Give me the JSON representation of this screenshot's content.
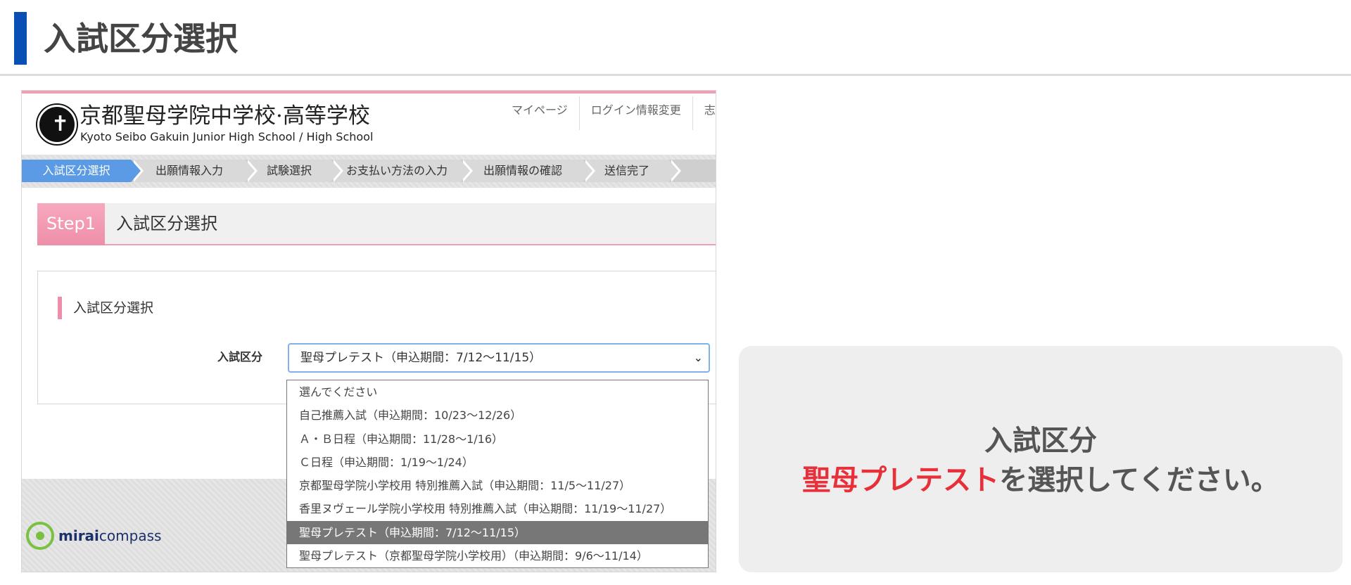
{
  "page": {
    "title": "入試区分選択"
  },
  "school": {
    "name_ja": "京都聖母学院中学校·高等学校",
    "name_en": "Kyoto Seibo Gakuin Junior High School / High School",
    "logo_icon": "cross-emblem-icon"
  },
  "topnav": [
    "マイページ",
    "ログイン情報変更",
    "志"
  ],
  "steps": [
    "入試区分選択",
    "出願情報入力",
    "試験選択",
    "お支払い方法の入力",
    "出願情報の確認",
    "送信完了"
  ],
  "step_head": {
    "badge": "Step1",
    "title": "入試区分選択"
  },
  "panel": {
    "title": "入試区分選択",
    "field_label": "入試区分",
    "selected_value": "聖母プレテスト（申込期間：7/12～11/15）"
  },
  "dropdown_options": [
    "選んでください",
    "自己推薦入試（申込期間：10/23～12/26）",
    "Ａ・Ｂ日程（申込期間：11/28～1/16）",
    "Ｃ日程（申込期間：1/19～1/24）",
    "京都聖母学院小学校用 特別推薦入試（申込期間：11/5～11/27）",
    "香里ヌヴェール学院小学校用 特別推薦入試（申込期間：11/19～11/27）",
    "聖母プレテスト（申込期間：7/12～11/15）",
    "聖母プレテスト（京都聖母学院小学校用）（申込期間：9/6～11/14）"
  ],
  "footer": {
    "brand_bold": "mirai",
    "brand_rest": "compass"
  },
  "callout": {
    "line1": "入試区分",
    "highlight": "聖母プレテスト",
    "line2_rest": "を選択してください。"
  },
  "colors": {
    "accent_blue": "#0a4fb3",
    "step_active": "#5b9be6",
    "pink": "#ee8ea8",
    "highlight_red": "#e8303a"
  }
}
